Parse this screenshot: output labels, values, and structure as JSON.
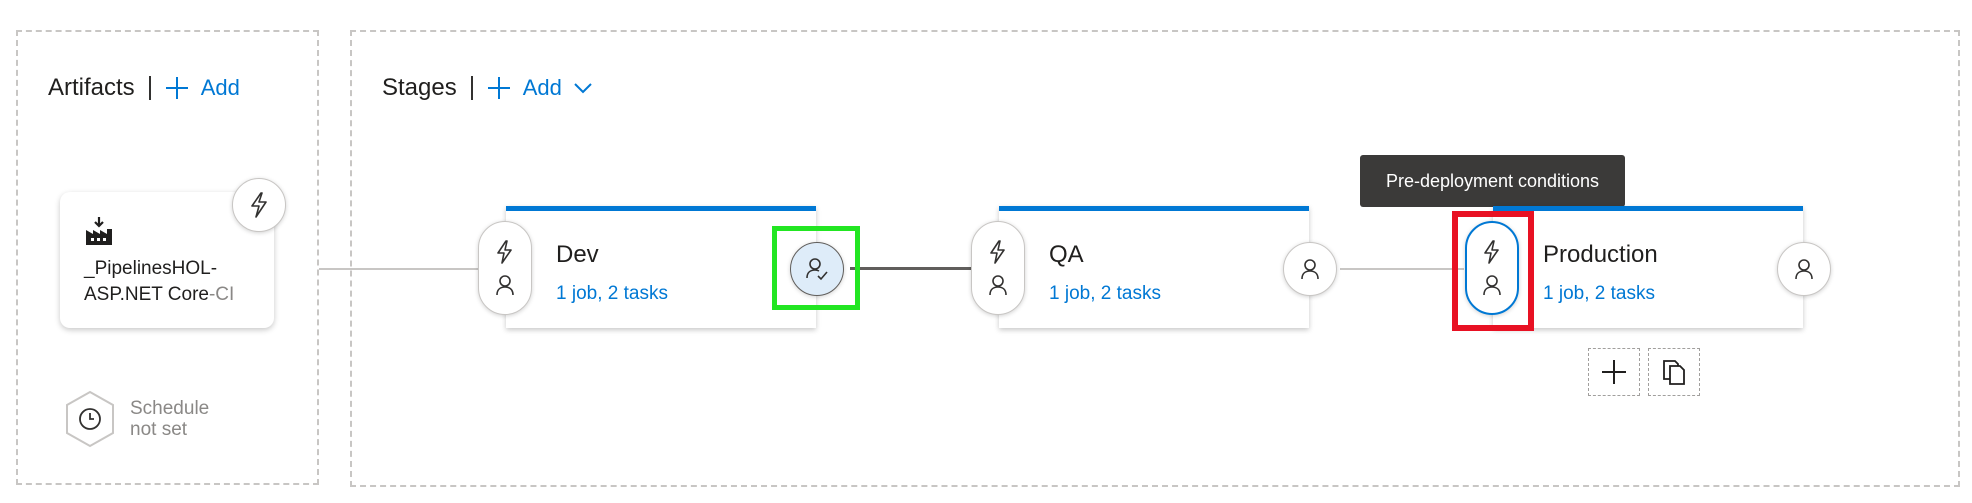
{
  "artifacts": {
    "title": "Artifacts",
    "add_label": "Add",
    "card": {
      "name_main": "_PipelinesHOL-\nASP.NET Core",
      "name_suffix": "-CI",
      "icon": "build-pipeline-icon",
      "trigger_icon": "lightning-icon"
    },
    "schedule": {
      "line1": "Schedule",
      "line2": "not set",
      "icon": "clock-icon"
    }
  },
  "stages": {
    "title": "Stages",
    "add_label": "Add",
    "items": [
      {
        "name": "Dev",
        "detail": "1 job, 2 tasks"
      },
      {
        "name": "QA",
        "detail": "1 job, 2 tasks"
      },
      {
        "name": "Production",
        "detail": "1 job, 2 tasks"
      }
    ]
  },
  "tooltip": {
    "text": "Pre-deployment conditions"
  },
  "colors": {
    "accent": "#0078d4",
    "highlight_green": "#22e622",
    "highlight_red": "#e81123",
    "tooltip_bg": "#3b3a39"
  },
  "icons": {
    "add": "plus-icon",
    "dropdown": "chevron-down-icon",
    "approver": "person-icon",
    "approved": "person-check-icon",
    "add_stage": "plus-icon",
    "clone_stage": "copy-icon"
  }
}
